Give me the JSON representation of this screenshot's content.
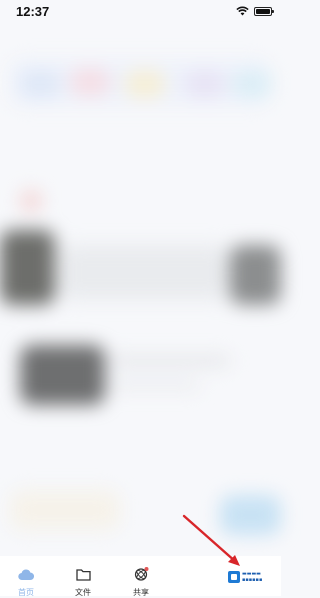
{
  "status_bar": {
    "time": "12:37"
  },
  "tab_bar": {
    "items": [
      {
        "label": "首页",
        "icon": "cloud-icon",
        "active": true
      },
      {
        "label": "文件",
        "icon": "folder-icon",
        "active": false
      },
      {
        "label": "共享",
        "icon": "share-icon",
        "active": false
      }
    ]
  },
  "colors": {
    "accent": "#8fb6e8",
    "arrow": "#d8262a",
    "watermark": "#1e7ad4"
  }
}
